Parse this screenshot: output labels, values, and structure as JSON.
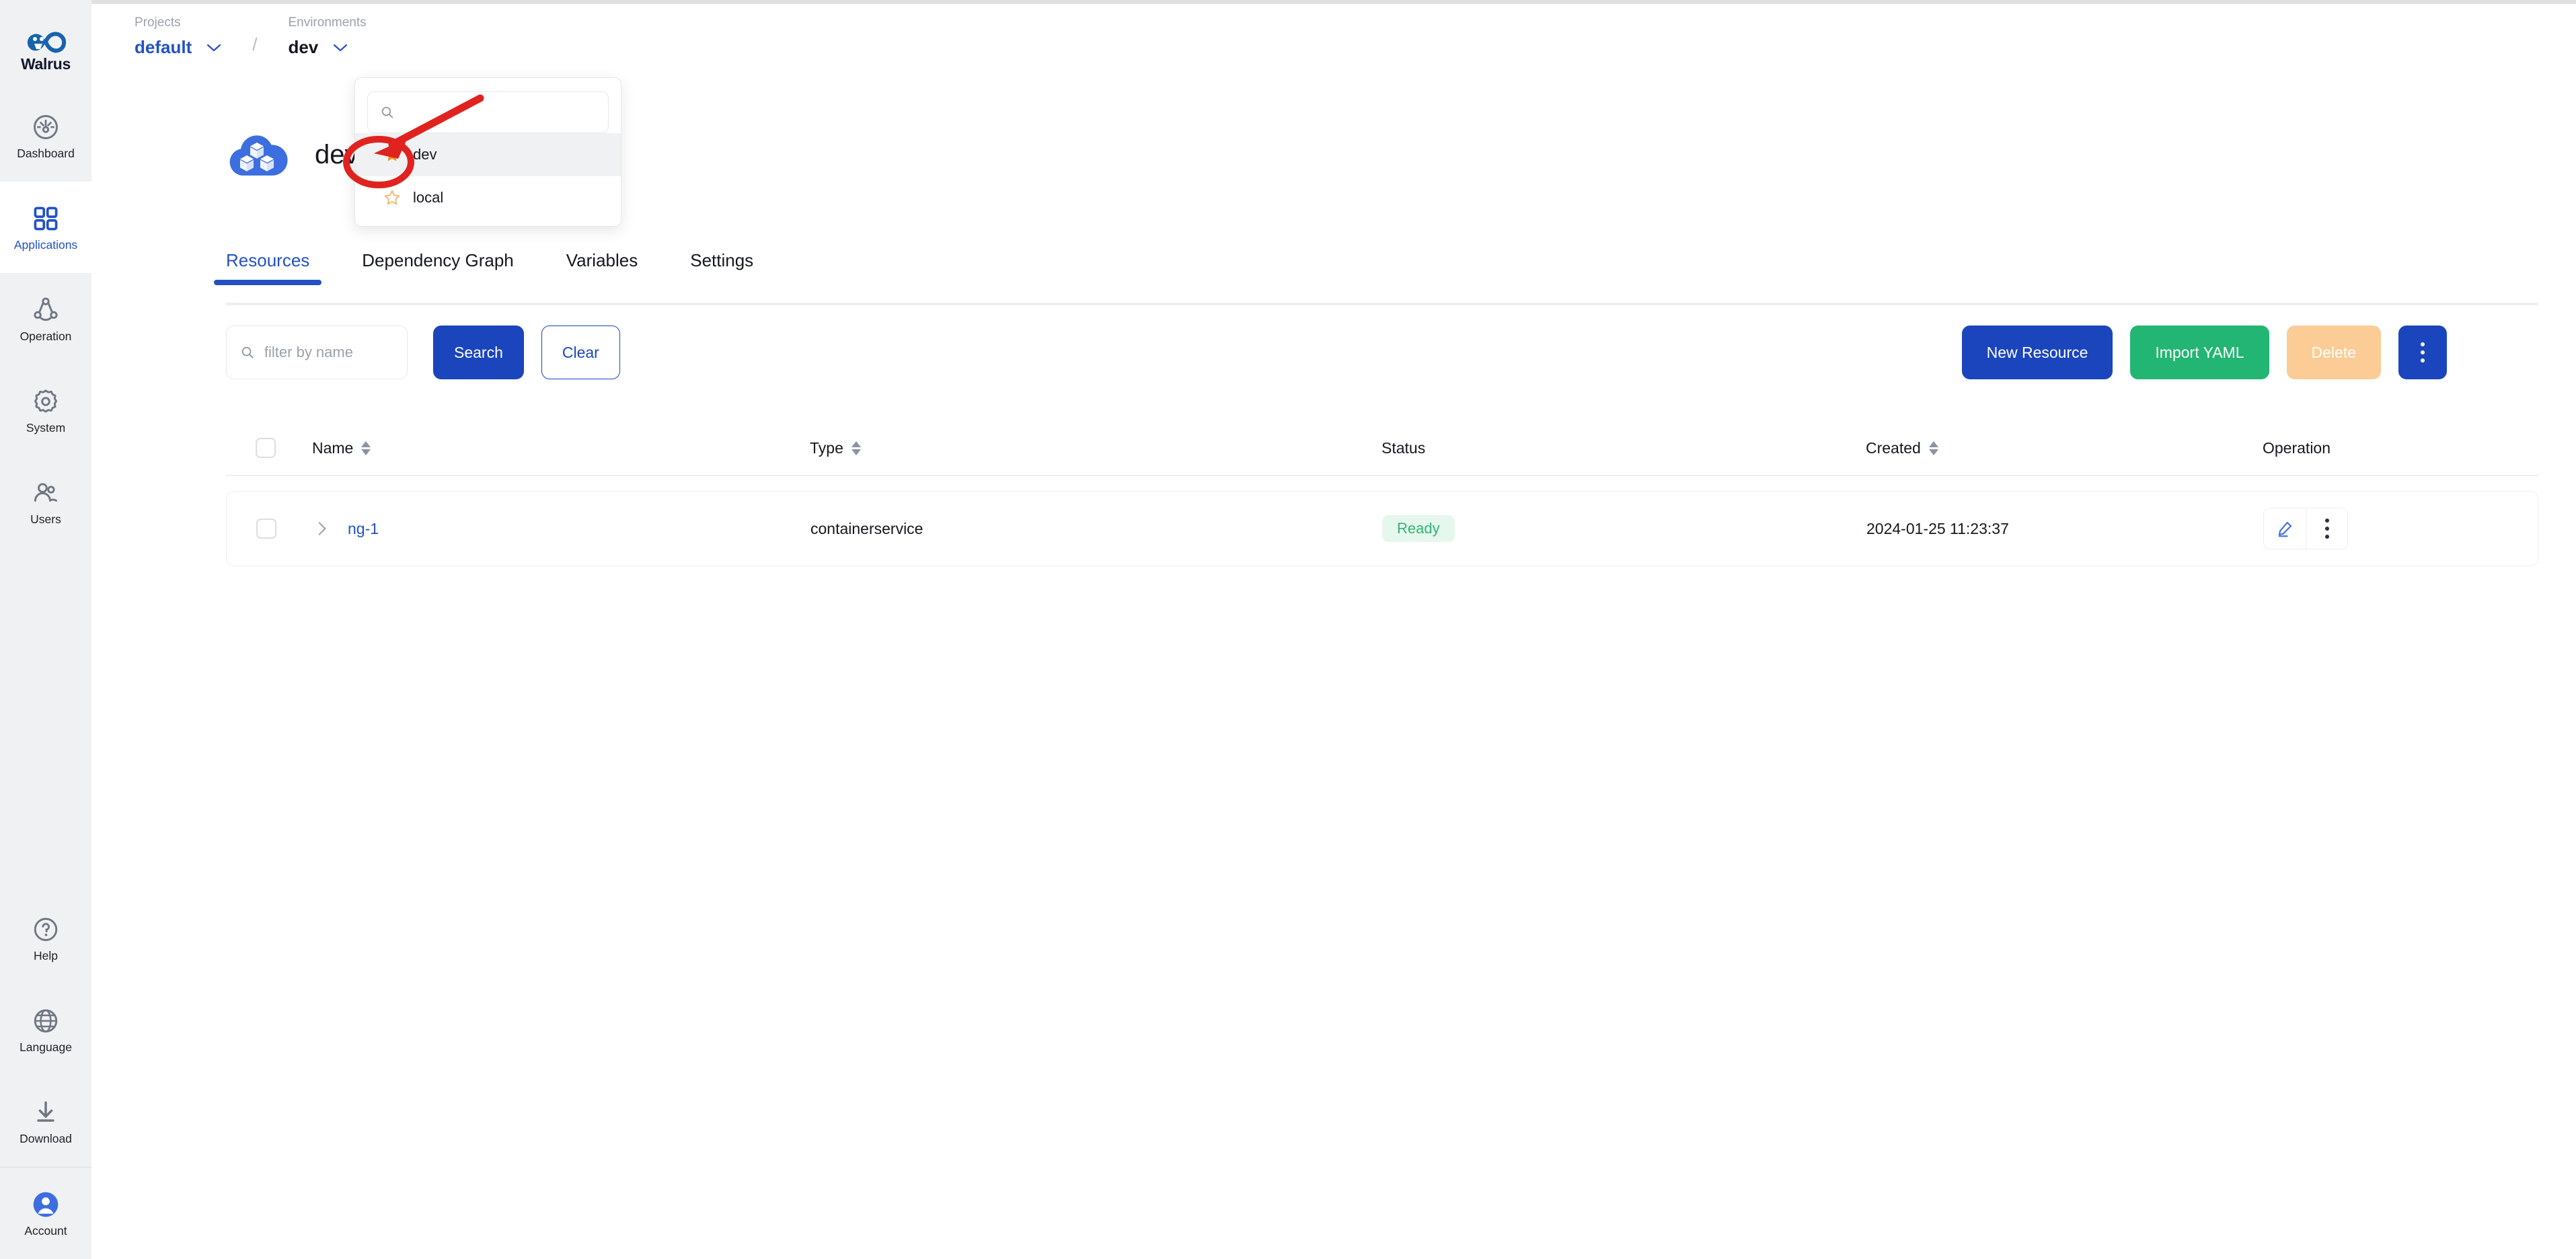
{
  "app": {
    "brand": "Walrus"
  },
  "sidebar": {
    "items": [
      {
        "label": "Dashboard",
        "icon": "dashboard-gauge-icon",
        "active": false
      },
      {
        "label": "Applications",
        "icon": "applications-grid-icon",
        "active": true
      },
      {
        "label": "Operation",
        "icon": "operation-network-icon",
        "active": false
      },
      {
        "label": "System",
        "icon": "system-gear-icon",
        "active": false
      },
      {
        "label": "Users",
        "icon": "users-people-icon",
        "active": false
      }
    ],
    "bottom_items": [
      {
        "label": "Help",
        "icon": "help-question-icon"
      },
      {
        "label": "Language",
        "icon": "language-globe-icon"
      },
      {
        "label": "Download",
        "icon": "download-arrow-icon"
      },
      {
        "label": "Account",
        "icon": "account-avatar-icon"
      }
    ]
  },
  "breadcrumb": {
    "projects_label": "Projects",
    "project_value": "default",
    "separator": "/",
    "environments_label": "Environments",
    "environment_value": "dev"
  },
  "env_dropdown": {
    "search_placeholder": "",
    "search_value": "",
    "options": [
      {
        "label": "dev",
        "starred": true,
        "selected": true
      },
      {
        "label": "local",
        "starred": false,
        "selected": false
      }
    ]
  },
  "page": {
    "title": "dev",
    "icon": "cloud-cubes-icon"
  },
  "tabs": [
    {
      "label": "Resources",
      "active": true
    },
    {
      "label": "Dependency Graph",
      "active": false
    },
    {
      "label": "Variables",
      "active": false
    },
    {
      "label": "Settings",
      "active": false
    }
  ],
  "toolbar": {
    "filter_placeholder": "filter by name",
    "filter_value": "",
    "search_label": "Search",
    "clear_label": "Clear",
    "new_resource_label": "New Resource",
    "import_yaml_label": "Import YAML",
    "delete_label": "Delete",
    "more_icon": "vertical-dots-icon"
  },
  "table": {
    "columns": [
      {
        "label": "Name",
        "sortable": true
      },
      {
        "label": "Type",
        "sortable": true
      },
      {
        "label": "Status",
        "sortable": false
      },
      {
        "label": "Created",
        "sortable": true
      },
      {
        "label": "Operation",
        "sortable": false
      }
    ],
    "rows": [
      {
        "name": "ng-1",
        "type": "containerservice",
        "status": "Ready",
        "created": "2024-01-25 11:23:37"
      }
    ]
  },
  "colors": {
    "brand_blue": "#2351c4",
    "primary_button": "#1b45bd",
    "success_green": "#22b573",
    "status_ready_text": "#2fb573",
    "status_ready_bg": "#e6f7ee",
    "delete_disabled": "#fbcc96",
    "star_filled": "#f7901e",
    "annotation_red": "#e0231f",
    "sidebar_bg": "#f0f1f3"
  }
}
